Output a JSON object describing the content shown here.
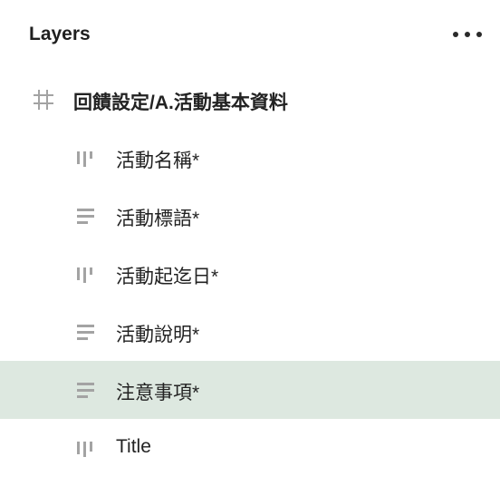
{
  "panel": {
    "title": "Layers",
    "menu_icon": "more-horizontal-icon",
    "frame": {
      "icon": "frame-hash-icon",
      "label": "回饋設定/A.活動基本資料"
    },
    "layers": [
      {
        "label": "活動名稱*",
        "icon": "columns-layout-icon",
        "selected": false
      },
      {
        "label": "活動標語*",
        "icon": "text-lines-icon",
        "selected": false
      },
      {
        "label": "活動起迄日*",
        "icon": "columns-layout-icon",
        "selected": false
      },
      {
        "label": "活動說明*",
        "icon": "text-lines-icon",
        "selected": false
      },
      {
        "label": "注意事項*",
        "icon": "text-lines-icon",
        "selected": true
      },
      {
        "label": "Title",
        "icon": "columns-layout-icon",
        "selected": false
      }
    ],
    "colors": {
      "selected_bg": "#dde8e0",
      "icon_gray": "#a3a3a3"
    }
  }
}
